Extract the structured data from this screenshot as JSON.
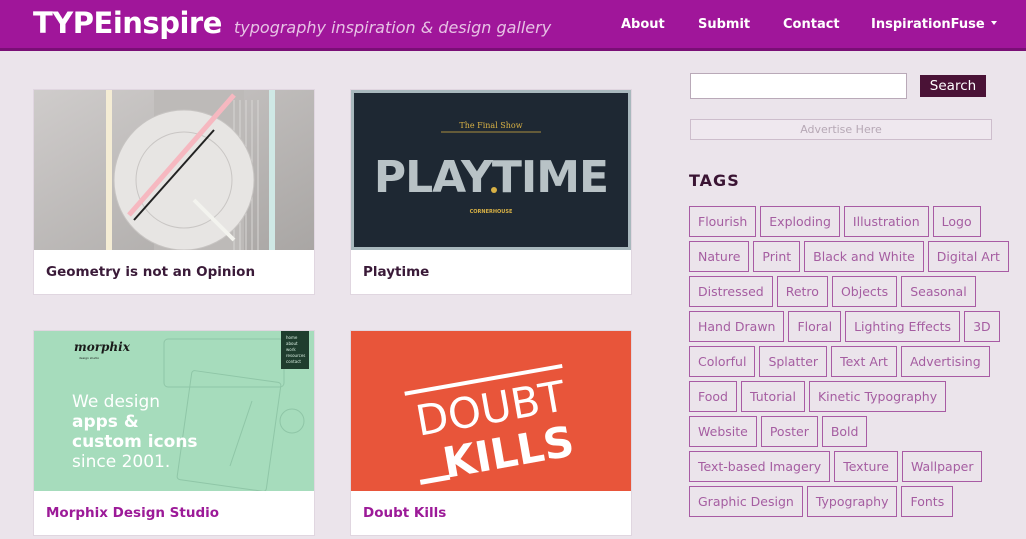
{
  "header": {
    "logo": "TYPEinspire",
    "tagline": "typography inspiration & design gallery",
    "nav": [
      "About",
      "Submit",
      "Contact",
      "InspirationFuse"
    ]
  },
  "cards": [
    {
      "title": "Geometry is not an Opinion"
    },
    {
      "title": "Playtime",
      "art_top": "The Final Show",
      "art_main": "PLAYTIME",
      "art_bottom": "CORNERHOUSE"
    },
    {
      "title": "Morphix Design Studio",
      "art_logo": "morphix",
      "art_sub": "design studio",
      "art_menu": [
        "home",
        "about",
        "work",
        "resources",
        "contact"
      ],
      "art_lines": [
        "We design",
        "apps &",
        "custom icons",
        "since 2001."
      ]
    },
    {
      "title": "Doubt Kills",
      "art_word1": "DOUBT",
      "art_word2": "KILLS"
    }
  ],
  "sidebar": {
    "search_button": "Search",
    "search_value": "",
    "advertise": "Advertise Here",
    "tags_heading": "TAGS",
    "tag_rows": [
      [
        "Flourish",
        "Exploding",
        "Illustration",
        "Logo"
      ],
      [
        "Nature",
        "Print",
        "Black and White",
        "Digital Art"
      ],
      [
        "Distressed",
        "Retro",
        "Objects",
        "Seasonal"
      ],
      [
        "Hand Drawn",
        "Floral",
        "Lighting Effects",
        "3D"
      ],
      [
        "Colorful",
        "Splatter",
        "Text Art",
        "Advertising"
      ],
      [
        "Food",
        "Tutorial",
        "Kinetic Typography"
      ],
      [
        "Website",
        "Poster",
        "Bold"
      ],
      [
        "Text-based Imagery",
        "Texture",
        "Wallpaper"
      ],
      [
        "Graphic Design",
        "Typography",
        "Fonts"
      ]
    ]
  },
  "colors": {
    "header": "#a0169a",
    "background": "#ebe4eb",
    "tag_border": "#a85ba4",
    "search_button": "#4a1236"
  }
}
